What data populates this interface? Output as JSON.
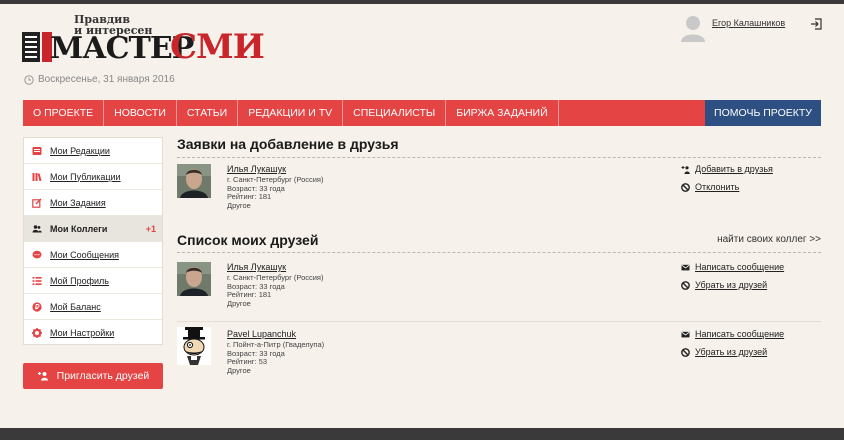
{
  "header": {
    "logo_tagline_1": "Правдив",
    "logo_tagline_2": "и интересен",
    "logo_word_1": "МАСТЕР",
    "logo_word_2": "СМИ",
    "date": "Воскресенье, 31 января 2016",
    "user_name": "Егор Калашников"
  },
  "nav": {
    "items": [
      "О ПРОЕКТЕ",
      "НОВОСТИ",
      "СТАТЬИ",
      "РЕДАКЦИИ И TV",
      "СПЕЦИАЛИСТЫ",
      "БИРЖА ЗАДАНИЙ"
    ],
    "help": "ПОМОЧЬ ПРОЕКТУ"
  },
  "sidebar": {
    "items": [
      {
        "label": "Мои Редакции",
        "icon": "newspaper-icon"
      },
      {
        "label": "Мои Публикации",
        "icon": "books-icon"
      },
      {
        "label": "Мои Задания",
        "icon": "edit-icon"
      },
      {
        "label": "Мои Коллеги",
        "icon": "users-icon",
        "badge": "+1"
      },
      {
        "label": "Мои Сообщения",
        "icon": "chat-icon"
      },
      {
        "label": "Мой Профиль",
        "icon": "list-icon"
      },
      {
        "label": "Мой Баланс",
        "icon": "coin-icon"
      },
      {
        "label": "Мои Настройки",
        "icon": "gear-icon"
      }
    ],
    "invite_label": "Пригласить друзей"
  },
  "requests": {
    "title": "Заявки на добавление в друзья",
    "people": [
      {
        "name": "Илья Лукашук",
        "city": "г. Санкт-Петербург (Россия)",
        "age": "Возраст: 33 года",
        "rating": "Рейтинг: 181",
        "other": "Другое",
        "action_1": "Добавить в друзья",
        "action_2": "Отклонить"
      }
    ]
  },
  "friends": {
    "title": "Список моих друзей",
    "find_link": "найти своих коллег >>",
    "people": [
      {
        "name": "Илья Лукашук",
        "city": "г. Санкт-Петербург (Россия)",
        "age": "Возраст: 33 года",
        "rating": "Рейтинг: 181",
        "other": "Другое",
        "action_1": "Написать сообщение",
        "action_2": "Убрать из друзей"
      },
      {
        "name": "Pavel Lupanchuk",
        "city": "г. Пойнт-а-Питр (Гваделупа)",
        "age": "Возраст: 33 года",
        "rating": "Рейтинг: 53",
        "other": "Другое",
        "action_1": "Написать сообщение",
        "action_2": "Убрать из друзей"
      }
    ]
  },
  "colors": {
    "accent_red": "#e44444",
    "nav_blue": "#2e4f82",
    "page_bg": "#f6f1ea"
  }
}
